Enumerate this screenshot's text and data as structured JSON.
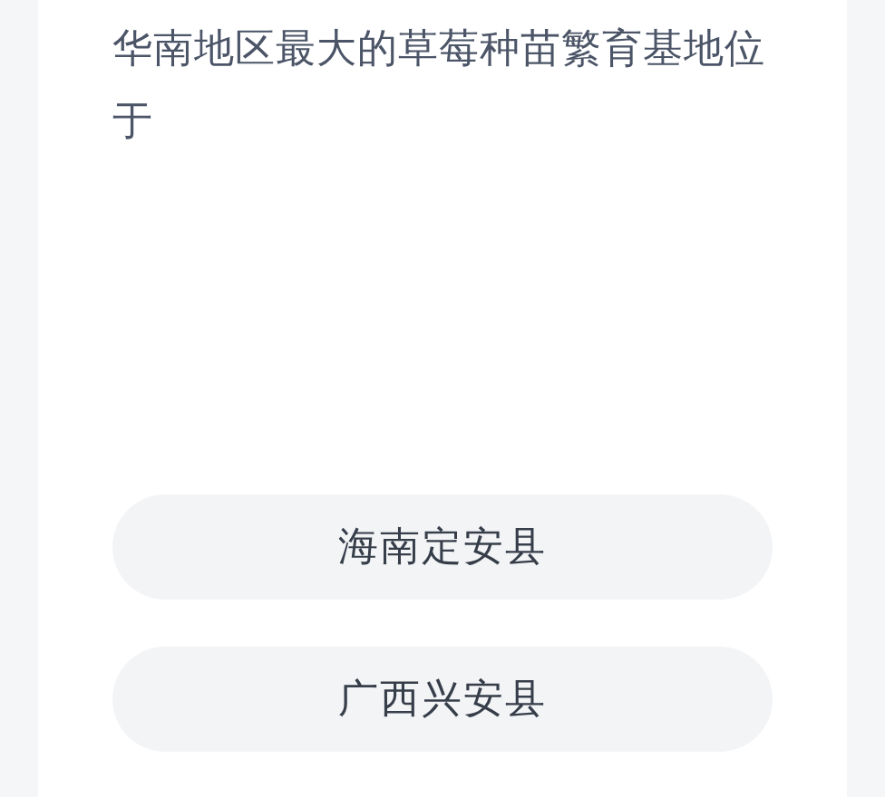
{
  "question": "华南地区最大的草莓种苗繁育基地位于",
  "options": [
    {
      "label": "海南定安县",
      "selected": false
    },
    {
      "label": "广西兴安县",
      "selected": false
    }
  ]
}
